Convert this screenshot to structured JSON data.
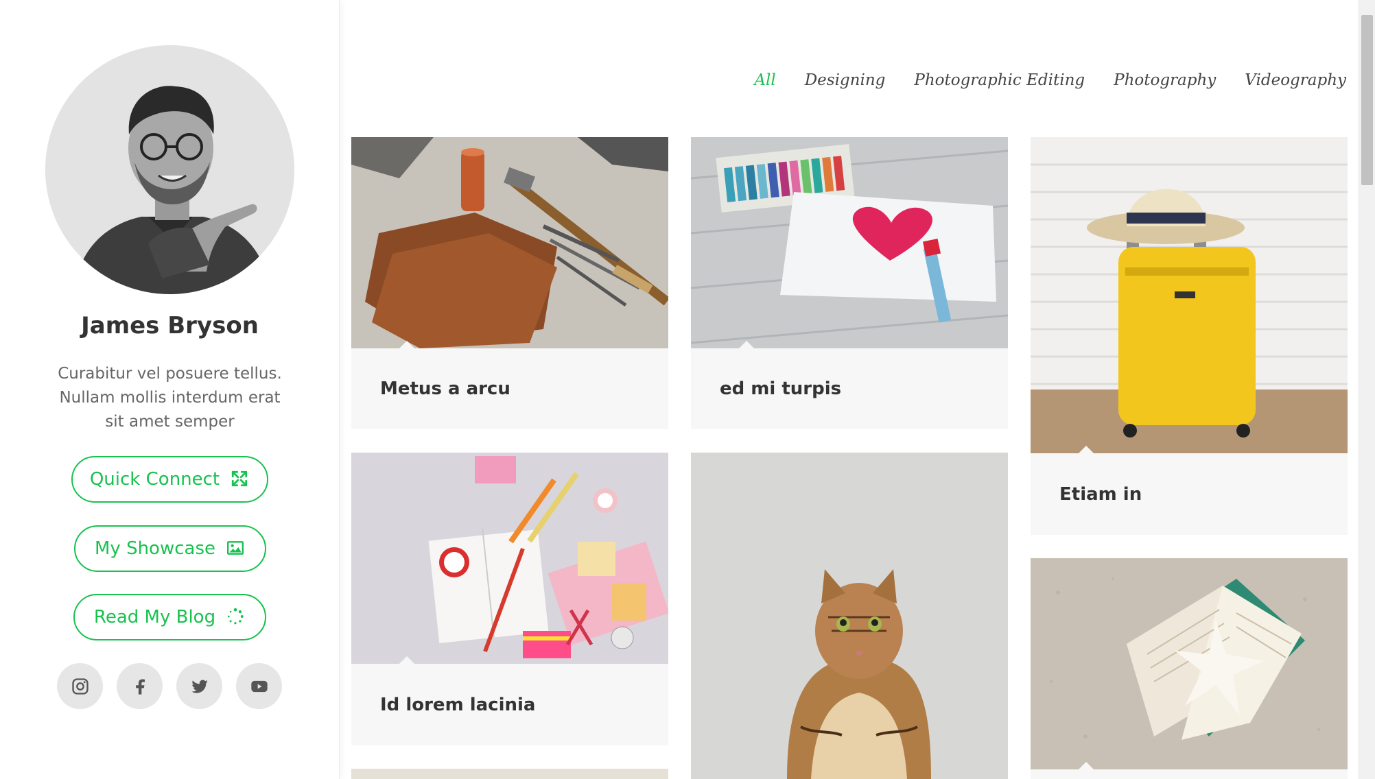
{
  "profile": {
    "name": "James Bryson",
    "bio": "Curabitur vel posuere tellus. Nullam mollis interdum erat sit amet semper",
    "buttons": {
      "quick_connect": "Quick Connect",
      "my_showcase": "My Showcase",
      "read_my_blog": "Read My Blog"
    },
    "socials": [
      "instagram-icon",
      "facebook-icon",
      "twitter-icon",
      "youtube-icon"
    ]
  },
  "filters": {
    "items": [
      "All",
      "Designing",
      "Photographic Editing",
      "Photography",
      "Videography"
    ],
    "active": "All"
  },
  "portfolio": {
    "items": [
      {
        "title": "Metus a arcu",
        "image": "leather-crafting-tools"
      },
      {
        "title": "ed mi turpis",
        "image": "crayon-heart-drawing"
      },
      {
        "title": "Etiam in",
        "image": "yellow-suitcase-with-hat"
      },
      {
        "title": "Id lorem lacinia",
        "image": "stationery-flatlay"
      },
      {
        "title": "",
        "image": "tabby-cat"
      },
      {
        "title": "",
        "image": "book-on-sand-with-starfish"
      }
    ]
  },
  "colors": {
    "accent": "#17c24e",
    "card_bg": "#f7f7f7",
    "text": "#333333"
  }
}
